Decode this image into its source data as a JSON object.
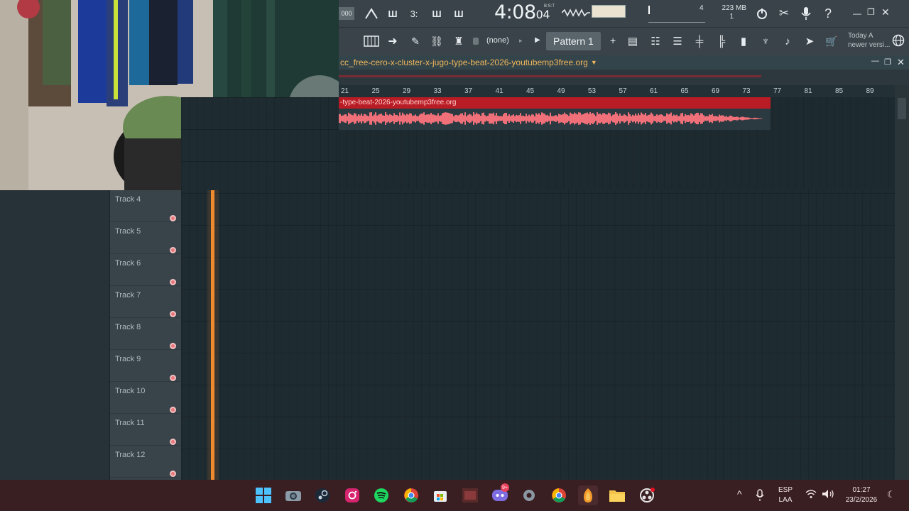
{
  "toolbar": {
    "mode_label": "000",
    "time_main": "4:08",
    "time_sub": "04",
    "time_format": "B:S:T",
    "cpu_value": "4",
    "memory_label": "223 MB",
    "polyphony_value": "1",
    "pattern_selector": "(none)",
    "pattern_label": "Pattern 1",
    "hint_text_line1": "Today  A",
    "hint_text_line2": "newer versi..."
  },
  "playlist": {
    "title": "cc_free-cero-x-cluster-x-jugo-type-beat-2026-youtubemp3free.org",
    "ruler_bars": [
      "21",
      "25",
      "29",
      "33",
      "37",
      "41",
      "45",
      "49",
      "53",
      "57",
      "61",
      "65",
      "69",
      "73",
      "77",
      "81",
      "85",
      "89"
    ],
    "clip_label": "-type-beat-2026-youtubemp3free.org",
    "tracks": [
      {
        "name": "Track 4"
      },
      {
        "name": "Track 5"
      },
      {
        "name": "Track 6"
      },
      {
        "name": "Track 7"
      },
      {
        "name": "Track 8"
      },
      {
        "name": "Track 9"
      },
      {
        "name": "Track 10"
      },
      {
        "name": "Track 11"
      },
      {
        "name": "Track 12"
      }
    ]
  },
  "taskbar": {
    "discord_badge": "9+",
    "language_line1": "ESP",
    "language_line2": "LAA",
    "clock_time": "01:27",
    "clock_date": "23/2/2026"
  },
  "colors": {
    "clip_red": "#b91c24",
    "waveform": "#f0707a",
    "playhead": "#f08a2e",
    "title_orange": "#f2b85b"
  }
}
